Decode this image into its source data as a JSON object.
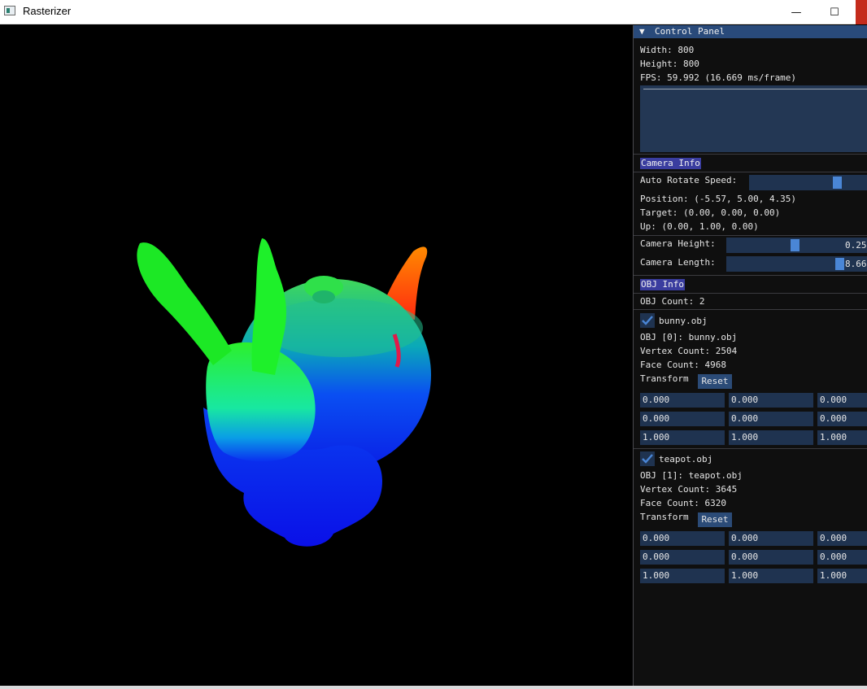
{
  "window": {
    "title": "Rasterizer",
    "min_glyph": "—",
    "max_glyph": "☐"
  },
  "panel": {
    "title": "Control Panel",
    "collapse_arrow": "▼",
    "width": "Width: 800",
    "height": "Height: 800",
    "fps": "FPS: 59.992 (16.669 ms/frame)",
    "camera": {
      "header": "Camera Info",
      "auto_rotate_label": "Auto Rotate Speed:",
      "auto_rotate_fraction": 0.76,
      "position": "Position: (-5.57, 5.00, 4.35)",
      "target": "Target: (0.00, 0.00, 0.00)",
      "up": "Up: (0.00, 1.00, 0.00)",
      "height_label": "Camera Height:",
      "height_value": "0.25",
      "length_label": "Camera Length:",
      "length_value": "8.66"
    },
    "obj": {
      "header": "OBJ Info",
      "count": "OBJ Count: 2",
      "items": [
        {
          "checkbox_label": "bunny.obj",
          "name": "OBJ [0]: bunny.obj",
          "vertex": "Vertex Count: 2504",
          "face": "Face Count: 4968",
          "transform_label": "Transform",
          "reset_label": "Reset",
          "rows": [
            [
              "0.000",
              "0.000",
              "0.000"
            ],
            [
              "0.000",
              "0.000",
              "0.000"
            ],
            [
              "1.000",
              "1.000",
              "1.000"
            ]
          ]
        },
        {
          "checkbox_label": "teapot.obj",
          "name": "OBJ [1]: teapot.obj",
          "vertex": "Vertex Count: 3645",
          "face": "Face Count: 6320",
          "transform_label": "Transform",
          "reset_label": "Reset",
          "rows": [
            [
              "0.000",
              "0.000",
              "0.000"
            ],
            [
              "0.000",
              "0.000",
              "0.000"
            ],
            [
              "1.000",
              "1.000",
              "1.000"
            ]
          ]
        }
      ]
    }
  },
  "colors": {
    "panel_bg": "#0f0f0f",
    "header_bg": "#294a7a",
    "frame_bg": "#1f3350",
    "accent": "#4a86d6",
    "section_bg": "#3a3d9f",
    "close": "#c42b1c"
  }
}
